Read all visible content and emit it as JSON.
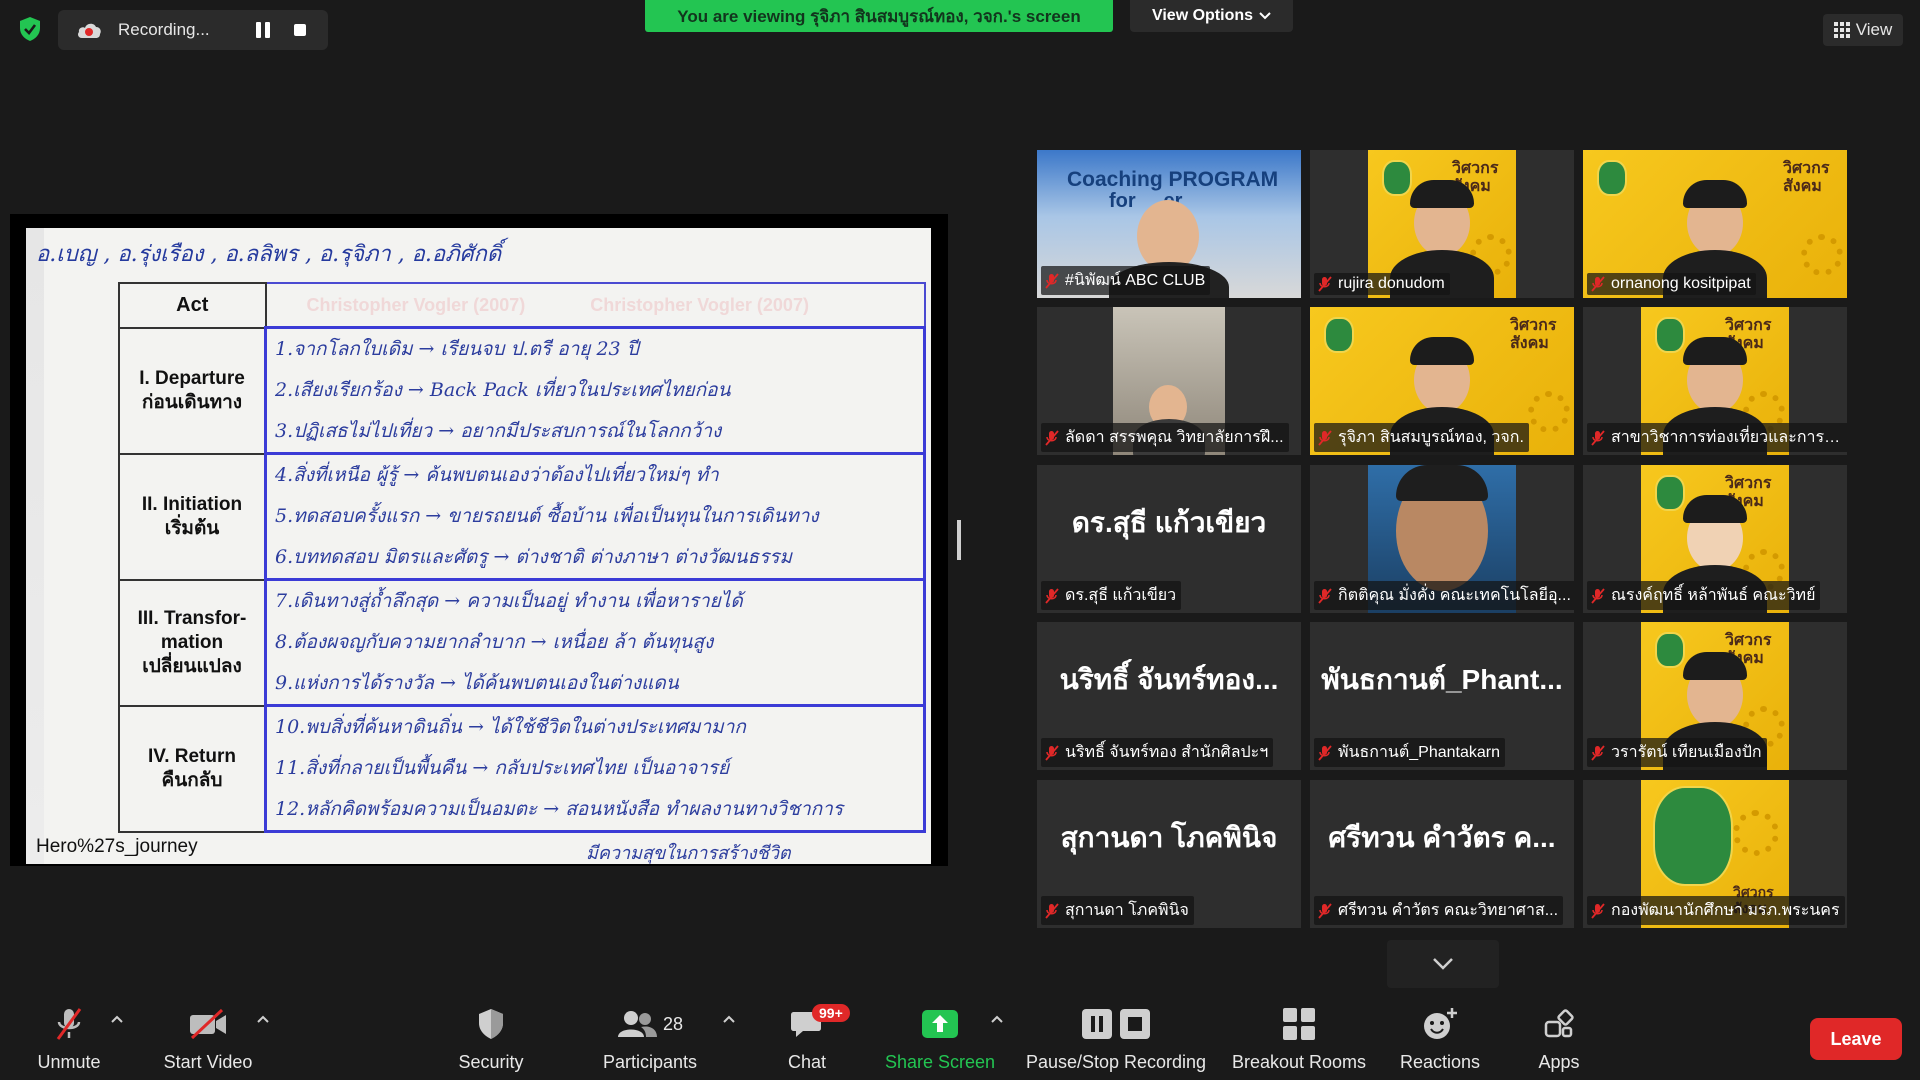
{
  "recording": {
    "label": "Recording..."
  },
  "banner": {
    "viewing": "You are viewing รุจิภา สินสมบูรณ์ทอง, วจก.'s screen",
    "view_options": "View Options"
  },
  "view_button": {
    "label": "View"
  },
  "slide": {
    "names_line": "อ.เบญ , อ.รุ่งเรือง , อ.ลลิพร , อ.รุจิภา , อ.อภิศักดิ์",
    "header_act": "Act",
    "ghost_header_1": "Christopher Vogler (2007)",
    "ghost_header_2": "Christopher Vogler (2007)",
    "acts": [
      {
        "title": "I. Departure",
        "subtitle": "ก่อนเดินทาง",
        "lines": [
          "1.จากโลกใบเดิม → เรียนจบ ป.ตรี อายุ 23 ปี",
          "2.เสียงเรียกร้อง → Back Pack เที่ยวในประเทศไทยก่อน",
          "3.ปฏิเสธไม่ไปเที่ยว → อยากมีประสบการณ์ในโลกกว้าง"
        ]
      },
      {
        "title": "II. Initiation",
        "subtitle": "เริ่มต้น",
        "lines": [
          "4.สิ่งที่เหนือ ผู้รู้ → ค้นพบตนเองว่าต้องไปเที่ยวใหม่ๆ ทำ",
          "5.ทดสอบครั้งแรก → ขายรถยนต์ ซื้อบ้าน เพื่อเป็นทุนในการเดินทาง",
          "6.บททดสอบ มิตรและศัตรู → ต่างชาติ ต่างภาษา ต่างวัฒนธรรม"
        ]
      },
      {
        "title": "III. Transfor-mation",
        "subtitle": "เปลี่ยนแปลง",
        "lines": [
          "7.เดินทางสู่ถ้ำลึกสุด → ความเป็นอยู่ ทำงาน เพื่อหารายได้",
          "8.ต้องผจญกับความยากลำบาก → เหนื่อย ล้า ต้นทุนสูง",
          "9.แห่งการได้รางวัล → ได้ค้นพบตนเองในต่างแดน"
        ]
      },
      {
        "title": "IV. Return",
        "subtitle": "คืนกลับ",
        "lines": [
          "10.พบสิ่งที่ค้นหาดินถิ่น → ได้ใช้ชีวิตในต่างประเทศมามาก",
          "11.สิ่งที่กลายเป็นพื้นคืน → กลับประเทศไทย เป็นอาจารย์",
          "12.หลักคิดพร้อมความเป็นอมตะ → สอนหนังสือ ทำผลงานทางวิชาการ"
        ]
      }
    ],
    "footer_left": "Hero%27s_journey",
    "footer_right": "มีความสุขในการสร้างชีวิต"
  },
  "participants_tiles": [
    {
      "name": "#นิพัฒน์ ABC CLUB",
      "kind": "video-coaching",
      "coaching_text": "Coaching PROGRAM",
      "coaching_sub": "for     er"
    },
    {
      "name": "rujira donudom",
      "kind": "video-yellow"
    },
    {
      "name": "ornanong kositpipat",
      "kind": "video-yellow"
    },
    {
      "name": "ลัดดา สรรพคุณ วิทยาลัยการฝึ...",
      "kind": "video-room"
    },
    {
      "name": "รุจิภา สินสมบูรณ์ทอง, วจก.",
      "kind": "video-yellow-active"
    },
    {
      "name": "สาขาวิชาการท่องเที่ยวและการโร...",
      "kind": "video-yellow"
    },
    {
      "name": "ดร.สุธี แก้วเขียว",
      "kind": "name-only",
      "display": "ดร.สุธี แก้วเขียว"
    },
    {
      "name": "กิตติคุณ มั่งคั่ง คณะเทคโนโลยีอุ...",
      "kind": "video-avatar"
    },
    {
      "name": "ณรงค์ฤทธิ์ หล้าพันธ์ คณะวิทย์",
      "kind": "video-yellow-avatar"
    },
    {
      "name": "นริทธิ์ จันทร์ทอง สำนักศิลปะฯ",
      "kind": "name-only",
      "display": "นริทธิ์ จันทร์ทอง..."
    },
    {
      "name": "พันธกานต์_Phantakarn",
      "kind": "name-only",
      "display": "พันธกานต์_Phant..."
    },
    {
      "name": "วรารัตน์ เทียนเมืองปัก",
      "kind": "video-yellow"
    },
    {
      "name": "สุกานดา โภคพินิจ",
      "kind": "name-only",
      "display": "สุกานดา โภคพินิจ"
    },
    {
      "name": "ศรีทวน คำวัตร คณะวิทยาศาส...",
      "kind": "name-only",
      "display": "ศรีทวน คำวัตร ค..."
    },
    {
      "name": "กองพัฒนานักศึกษา มรภ.พระนคร",
      "kind": "video-logo"
    }
  ],
  "yellow_card_text": "วิศวกรสังคม",
  "toolbar": {
    "unmute": "Unmute",
    "start_video": "Start Video",
    "security": "Security",
    "participants": "Participants",
    "participants_count": "28",
    "chat": "Chat",
    "chat_badge": "99+",
    "share_screen": "Share Screen",
    "pause_stop": "Pause/Stop Recording",
    "breakout": "Breakout Rooms",
    "reactions": "Reactions",
    "apps": "Apps",
    "leave": "Leave"
  },
  "colors": {
    "accent_green": "#23c552",
    "leave_red": "#e02828",
    "active_speaker": "#f6c744",
    "background": "#1a1a1a"
  }
}
